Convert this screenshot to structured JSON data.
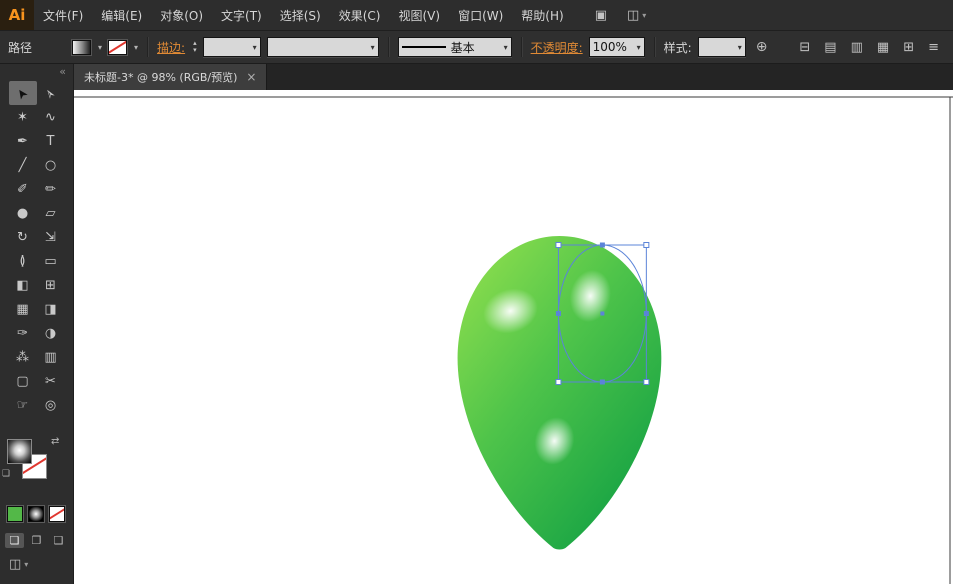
{
  "app": {
    "logo_text": "Ai"
  },
  "ui": {
    "dropdown_arrow": "▾",
    "step_up": "▴",
    "step_down": "▾",
    "swap_glyph": "⇄",
    "default_chips_glyph": "❏",
    "globe_glyph": "⊕",
    "collapse_glyph": "«"
  },
  "menubar": {
    "items": [
      {
        "label": "文件(F)"
      },
      {
        "label": "编辑(E)"
      },
      {
        "label": "对象(O)"
      },
      {
        "label": "文字(T)"
      },
      {
        "label": "选择(S)"
      },
      {
        "label": "效果(C)"
      },
      {
        "label": "视图(V)"
      },
      {
        "label": "窗口(W)"
      },
      {
        "label": "帮助(H)"
      }
    ],
    "appbar_icons": [
      {
        "name": "arrange-documents",
        "glyph": "▣"
      },
      {
        "name": "workspace-switcher",
        "glyph": "◫"
      }
    ]
  },
  "control_bar": {
    "context_label": "路径",
    "stroke_link": "描边:",
    "stroke_width_value": "",
    "brush_value": "基本",
    "opacity_link": "不透明度:",
    "opacity_value": "100%",
    "style_label": "样式:",
    "right_icons": [
      {
        "name": "align-dropdown",
        "glyph": "⊟"
      },
      {
        "name": "horizontal-align-left",
        "glyph": "▤"
      },
      {
        "name": "horizontal-align-center",
        "glyph": "▥"
      },
      {
        "name": "horizontal-align-right",
        "glyph": "▦"
      },
      {
        "name": "transform-panel",
        "glyph": "⊞"
      },
      {
        "name": "panel-menu",
        "glyph": "≡"
      }
    ]
  },
  "document_tab": {
    "title": "未标题-3* @ 98% (RGB/预览)",
    "close_glyph": "×"
  },
  "toolbar": {
    "tools": [
      {
        "name": "selection",
        "glyph": "➤"
      },
      {
        "name": "direct-selection",
        "glyph": "➢"
      },
      {
        "name": "magic-wand",
        "glyph": "✶"
      },
      {
        "name": "lasso",
        "glyph": "∿"
      },
      {
        "name": "pen",
        "glyph": "✒"
      },
      {
        "name": "type",
        "glyph": "T"
      },
      {
        "name": "line-segment",
        "glyph": "╱"
      },
      {
        "name": "ellipse",
        "glyph": "○"
      },
      {
        "name": "paintbrush",
        "glyph": "✐"
      },
      {
        "name": "pencil",
        "glyph": "✏"
      },
      {
        "name": "blob-brush",
        "glyph": "●"
      },
      {
        "name": "eraser",
        "glyph": "▱"
      },
      {
        "name": "rotate",
        "glyph": "↻"
      },
      {
        "name": "scale",
        "glyph": "⇲"
      },
      {
        "name": "width-tool",
        "glyph": "≬"
      },
      {
        "name": "free-transform",
        "glyph": "▭"
      },
      {
        "name": "shape-builder",
        "glyph": "◧"
      },
      {
        "name": "perspective-grid",
        "glyph": "⊞"
      },
      {
        "name": "mesh",
        "glyph": "▦"
      },
      {
        "name": "gradient",
        "glyph": "◨"
      },
      {
        "name": "eyedropper",
        "glyph": "✑"
      },
      {
        "name": "blend",
        "glyph": "◑"
      },
      {
        "name": "symbol-sprayer",
        "glyph": "⁂"
      },
      {
        "name": "column-graph",
        "glyph": "▥"
      },
      {
        "name": "artboard",
        "glyph": "▢"
      },
      {
        "name": "slice",
        "glyph": "✂"
      },
      {
        "name": "hand",
        "glyph": "☞"
      },
      {
        "name": "zoom",
        "glyph": "◎"
      }
    ],
    "draw_modes": [
      {
        "name": "draw-normal",
        "glyph": "❏"
      },
      {
        "name": "draw-behind",
        "glyph": "❐"
      },
      {
        "name": "draw-inside",
        "glyph": "❑"
      }
    ],
    "screen_mode_glyph": "◫"
  },
  "canvas": {
    "colors": {
      "green_light": "#97e24e",
      "green_mid": "#4fc44a",
      "green_dark": "#0e9e43",
      "selection_blue": "#5b84d8",
      "swatch_green": "#53b848",
      "slash_red": "#e0372f",
      "accent_orange": "#e08a35"
    }
  }
}
